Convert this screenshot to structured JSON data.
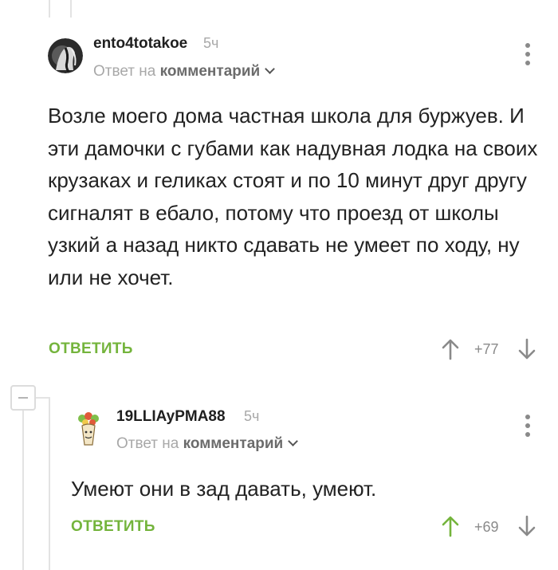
{
  "comments": [
    {
      "username": "ento4totakoe",
      "time": "5ч",
      "reply_prefix": "Ответ на",
      "reply_link": "комментарий",
      "body": "Возле моего дома частная школа для буржуев. И эти дамочки с губами как надувная лодка на своих крузаках и геликах стоят и по 10 минут друг другу сигналят в ебало, потому что проезд от школы узкий а назад никто сдавать не умеет по ходу, ну или не хочет.",
      "reply_button": "ОТВЕТИТЬ",
      "score": "+77",
      "upvote_active": false
    },
    {
      "username": "19LLIAyPMA88",
      "time": "5ч",
      "reply_prefix": "Ответ на",
      "reply_link": "комментарий",
      "body": "Умеют они в зад давать, умеют.",
      "reply_button": "ОТВЕТИТЬ",
      "score": "+69",
      "upvote_active": true
    }
  ],
  "colors": {
    "accent_green": "#74b43c",
    "muted_gray": "#a8a8a8",
    "icon_gray": "#8a8a8a"
  },
  "icons": [
    "avatar-bw-figure",
    "avatar-cartoon-plant",
    "more-vertical-icon",
    "chevron-down-icon",
    "arrow-up-icon",
    "arrow-down-icon",
    "collapse-minus-icon"
  ]
}
